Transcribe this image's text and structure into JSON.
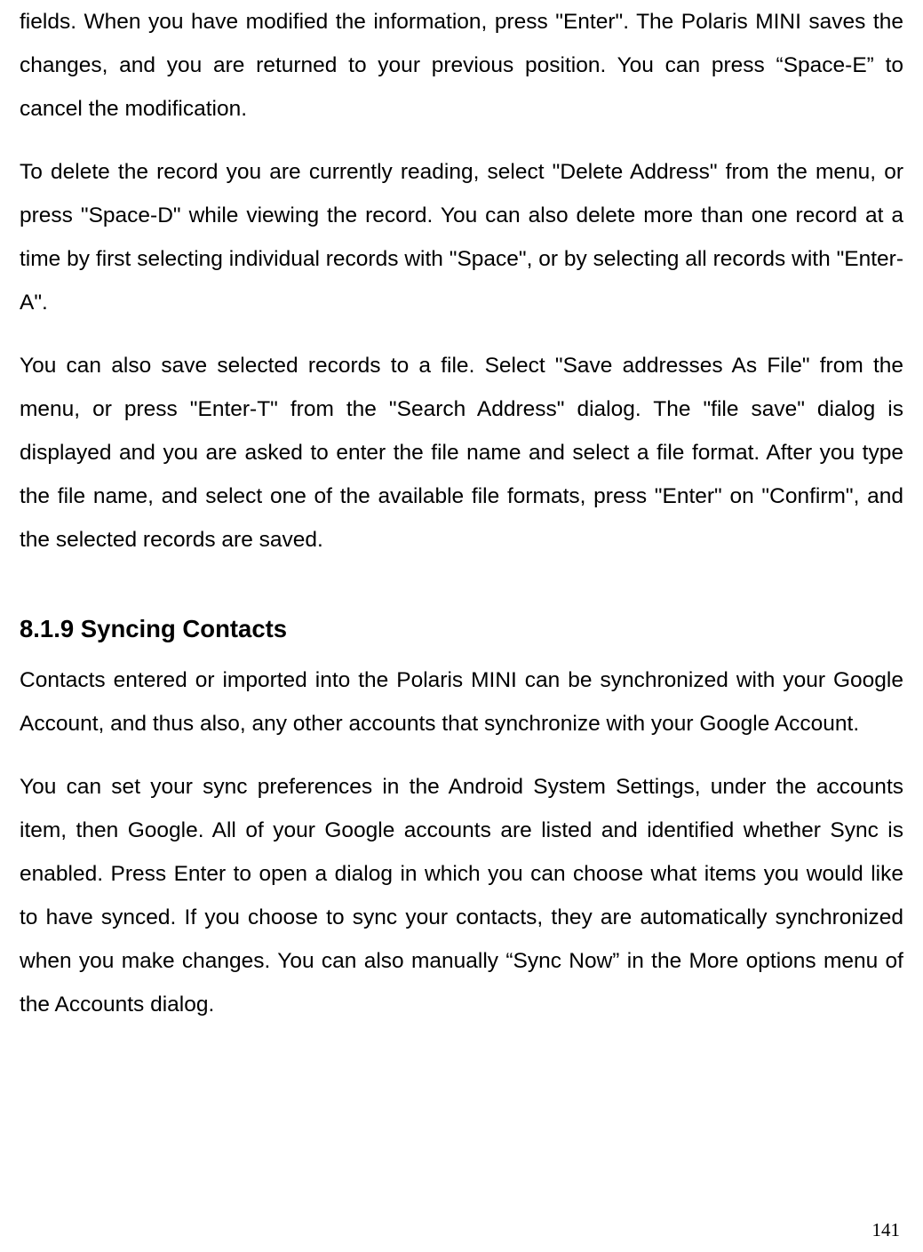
{
  "paragraphs": {
    "p1": "fields. When you have modified the information, press \"Enter\". The Polaris MINI saves the changes, and you are returned to your previous position. You can press “Space-E” to cancel the modification.",
    "p2": "To delete the record you are currently reading, select \"Delete Address\" from the menu, or press \"Space-D\" while viewing the record. You can also delete more than one record at a time by first selecting individual records with \"Space\", or by selecting all records with \"Enter-A\".",
    "p3": "You can also save selected records to a file. Select \"Save addresses As File\" from the menu, or press \"Enter-T\" from the \"Search Address\" dialog. The \"file save\" dialog is displayed and you are asked to enter the file name and select a file format. After you type the file name, and select one of the available file formats, press \"Enter\" on \"Confirm\", and the selected records are saved."
  },
  "heading": "8.1.9 Syncing Contacts",
  "section_paragraphs": {
    "sp1": "Contacts entered or imported into the Polaris MINI can be synchronized with your Google Account, and thus also, any other accounts that synchronize with your Google Account.",
    "sp2": "You can set your sync preferences in the Android System Settings, under the accounts item, then Google. All of your Google accounts are listed and identified whether Sync is enabled. Press Enter to open a dialog in which you can choose what items you would like to have synced. If you choose to sync your contacts, they are automatically synchronized when you make changes. You can also manually “Sync Now” in the More options menu of the Accounts dialog."
  },
  "page_number": "141"
}
